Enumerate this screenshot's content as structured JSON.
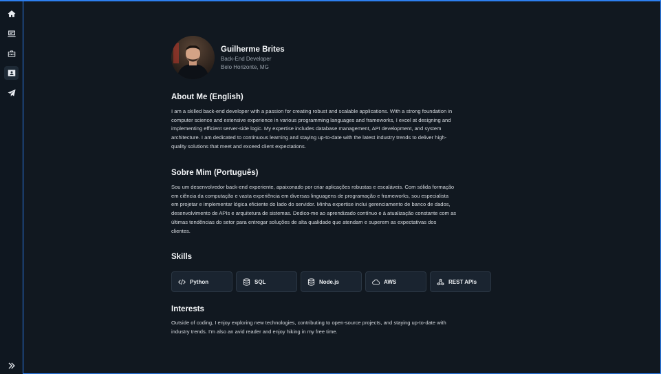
{
  "profile": {
    "name": "Guilherme Brites",
    "role": "Back-End Developer",
    "location": "Belo Horizonte, MG"
  },
  "sidebar": {
    "items": [
      {
        "icon": "home-icon"
      },
      {
        "icon": "monitor-icon"
      },
      {
        "icon": "briefcase-icon"
      },
      {
        "icon": "contact-card-icon",
        "active": true
      },
      {
        "icon": "send-icon"
      }
    ],
    "expand_icon": "double-chevron-right-icon"
  },
  "about_en": {
    "title": "About Me (English)",
    "lines": [
      "I am a skilled back-end developer with a passion for creating robust and scalable applications. With a strong foundation in",
      "computer science and extensive experience in various programming languages and frameworks, I excel at designing and",
      "implementing efficient server-side logic. My expertise includes database management, API development, and system",
      "architecture. I am dedicated to continuous learning and staying up-to-date with the latest industry trends to deliver high-",
      "quality solutions that meet and exceed client expectations."
    ]
  },
  "about_pt": {
    "title": "Sobre Mim (Português)",
    "lines": [
      "Sou um desenvolvedor back-end experiente, apaixonado por criar aplicações robustas e escaláveis. Com sólida formação",
      "em ciência da computação e vasta experiência em diversas linguagens de programação e frameworks, sou especialista",
      "em projetar e implementar lógica eficiente do lado do servidor. Minha expertise inclui gerenciamento de banco de dados,",
      "desenvolvimento de APIs e arquitetura de sistemas. Dedico-me ao aprendizado contínuo e à atualização constante com as",
      "últimas tendências do setor para entregar soluções de alta qualidade que atendam e superem as expectativas dos",
      "clientes."
    ]
  },
  "skills": {
    "title": "Skills",
    "items": [
      {
        "label": "Python",
        "icon": "code-icon"
      },
      {
        "label": "SQL",
        "icon": "database-icon"
      },
      {
        "label": "Node.js",
        "icon": "database-icon"
      },
      {
        "label": "AWS",
        "icon": "cloud-icon"
      },
      {
        "label": "REST APIs",
        "icon": "webhook-icon"
      }
    ]
  },
  "interests": {
    "title": "Interests",
    "lines": [
      "Outside of coding, I enjoy exploring new technologies, contributing to open-source projects, and staying up-to-date with",
      "industry trends. I'm also an avid reader and enjoy hiking in my free time."
    ]
  },
  "colors": {
    "accent": "#2d7ff0",
    "background": "#111820",
    "card": "#1a2430"
  }
}
